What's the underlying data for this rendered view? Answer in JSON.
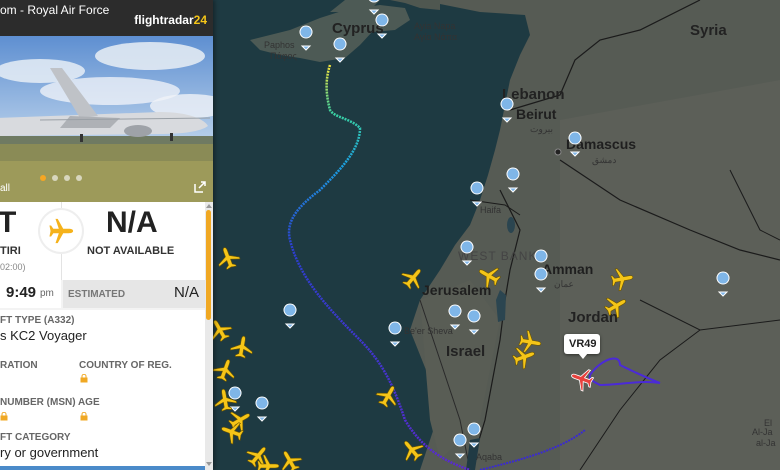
{
  "header": {
    "title": "om - Royal Air Force",
    "logo_text": "flightradar",
    "logo_num": "24"
  },
  "photo": {
    "caption": "all",
    "dots": 4,
    "active_dot": 0
  },
  "route": {
    "origin_code": "T",
    "origin_name": "TIRI",
    "origin_tz": "02:00)",
    "dest_code": "N/A",
    "dest_name": "NOT AVAILABLE"
  },
  "times": {
    "actual": "9:49",
    "actual_suffix": "pm",
    "estimated_label": "ESTIMATED",
    "estimated_value": "N/A"
  },
  "aircraft": {
    "type_label": "FT TYPE (A332)",
    "type_value": "s KC2 Voyager",
    "registration_label": "RATION",
    "country_label": "COUNTRY OF REG.",
    "msn_label": "NUMBER (MSN) AGE",
    "category_label": "FT CATEGORY",
    "category_value": "ry or government"
  },
  "map": {
    "labels": {
      "cyprus": "Cyprus",
      "ayia_napa": "Ayia Napa",
      "ayia_napa_gr": "Αγία Νάπα",
      "paphos": "Paphos",
      "paphos_gr": "Πάφος",
      "lebanon": "Lebanon",
      "beirut": "Beirut",
      "beirut_ar": "بيروت",
      "damascus": "Damascus",
      "damascus_ar": "دمشق",
      "syria": "Syria",
      "haifa": "Haifa",
      "haifa_he": "חיפה",
      "west_bank": "WEST BANK",
      "amman": "Amman",
      "amman_ar": "عمان",
      "jerusalem": "Jerusalem",
      "jerusalem_he": "ירושלים",
      "beersheva": "Be'er Sheva",
      "jordan": "Jordan",
      "israel": "Israel",
      "aqaba": "Aqaba",
      "al_jawf": "Al-Ja",
      "al_jawf2": "al-Ja",
      "el": "El"
    },
    "flight_callout": "VR49",
    "accent_color": "#f5c518",
    "selected_color": "#e8413c"
  }
}
